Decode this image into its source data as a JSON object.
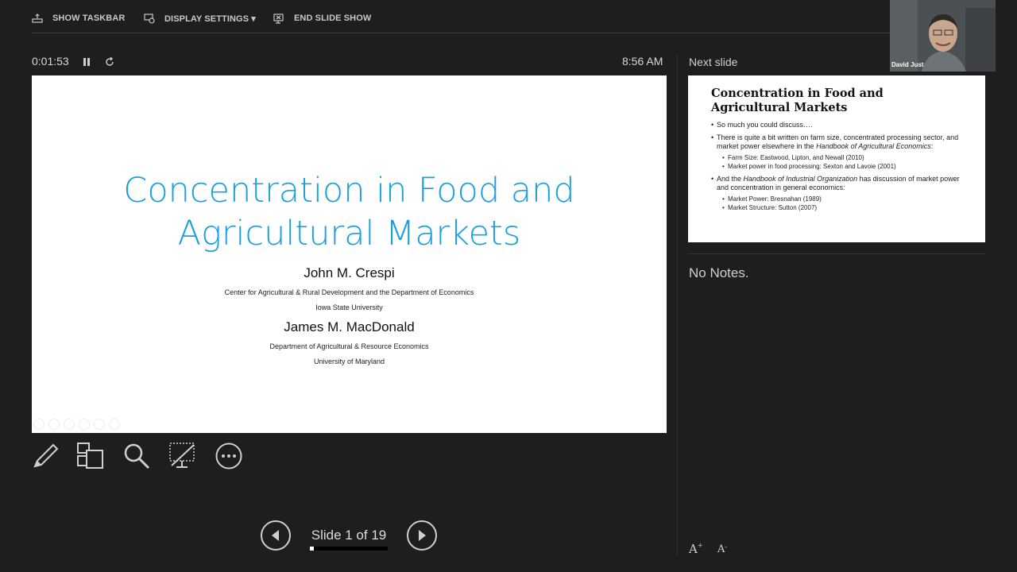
{
  "toolbar": {
    "show_taskbar": "SHOW TASKBAR",
    "display_settings": "DISPLAY SETTINGS ▾",
    "end_slide_show": "END SLIDE SHOW"
  },
  "timer": {
    "elapsed": "0:01:53",
    "clock": "8:56 AM"
  },
  "slide": {
    "title_line1": "Concentration in Food and",
    "title_line2": "Agricultural Markets",
    "author1": "John M. Crespi",
    "author1_affil1": "Center for Agricultural & Rural Development and the Department of Economics",
    "author1_affil2": "Iowa State University",
    "author2": "James M. MacDonald",
    "author2_affil1": "Department of Agricultural & Resource Economics",
    "author2_affil2": "University of Maryland"
  },
  "navigation": {
    "counter": "Slide 1 of 19",
    "progress": 0.0526
  },
  "next": {
    "label": "Next slide",
    "title": "Concentration in Food and Agricultural Markets",
    "b1": "So much you could discuss….",
    "b2_pre": "There is quite a bit written on farm size, concentrated processing sector, and market power elsewhere in the ",
    "b2_em": "Handbook of Agricultural Economics",
    "b2_post": ":",
    "b2_s1": "Farm Size: Eastwood, Lipton, and Newall (2010)",
    "b2_s2": "Market power in food processing: Sexton and Lavoie (2001)",
    "b3_pre": "And the ",
    "b3_em": "Handbook of Industrial Organization",
    "b3_post": " has discussion of market power and concentration in general economics:",
    "b3_s1": "Market Power: Bresnahan (1989)",
    "b3_s2": "Market Structure: Sutton (2007)"
  },
  "notes": {
    "text": "No Notes."
  },
  "font_controls": {
    "increase": "A",
    "decrease": "A"
  },
  "webcam": {
    "name": "David Just"
  }
}
